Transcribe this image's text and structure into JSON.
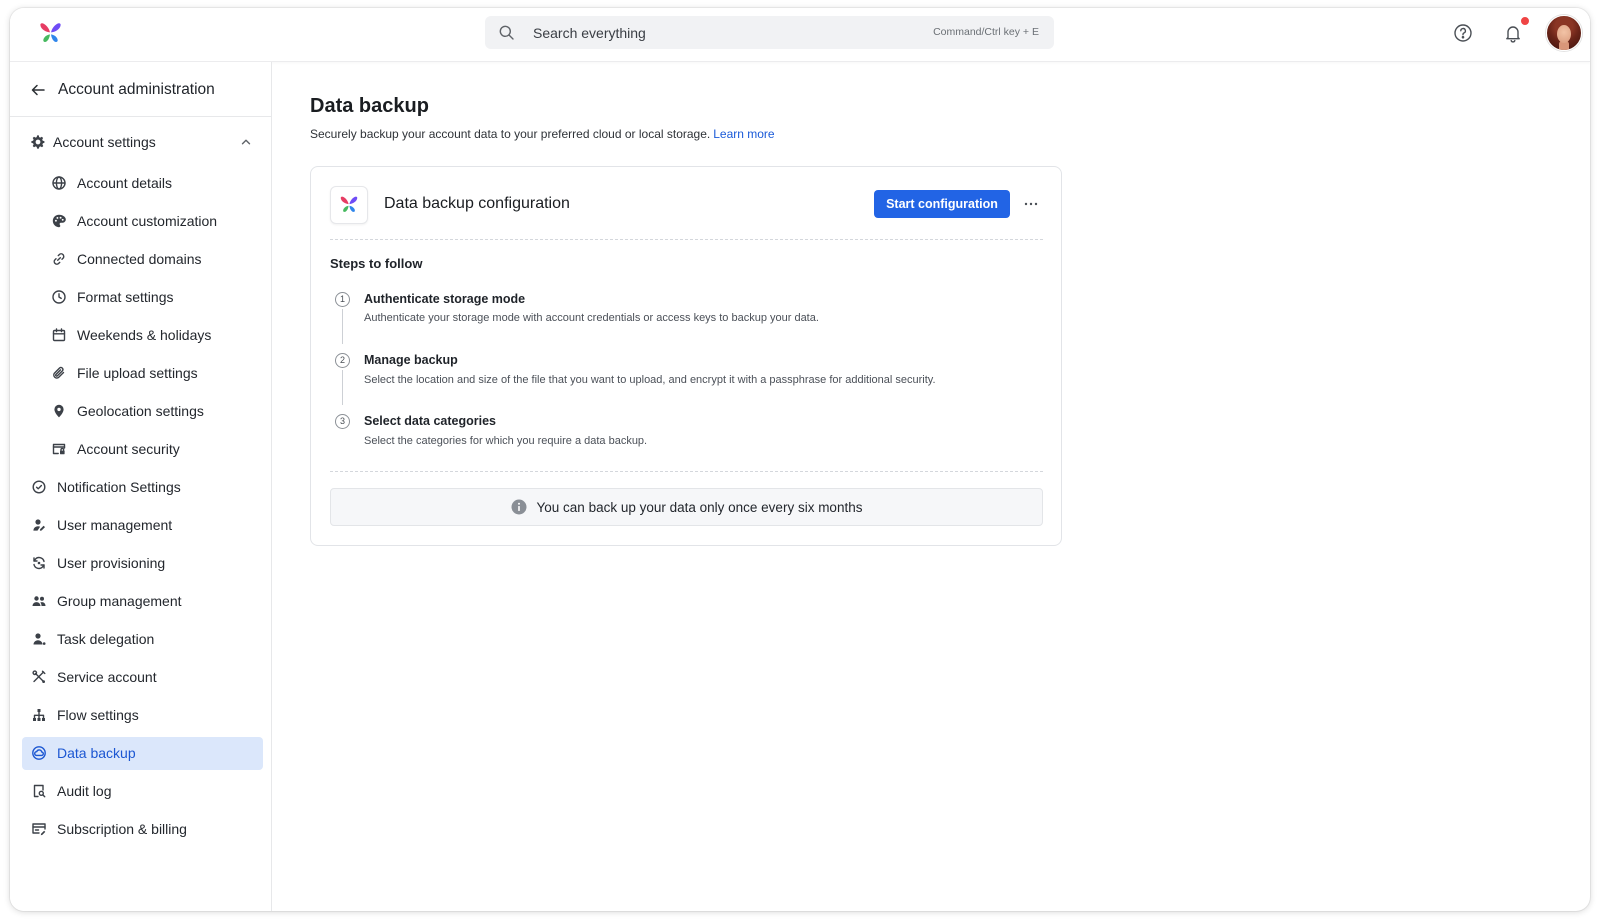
{
  "app": {
    "logo": "butterfly-logo"
  },
  "header": {
    "search": {
      "icon": "search-icon",
      "placeholder": "Search everything",
      "shortcut": "Command/Ctrl key + E"
    },
    "help_icon": "help-circle-icon",
    "notifications": {
      "icon": "bell-icon",
      "has_unread": true
    },
    "avatar": "user-avatar"
  },
  "sidebar": {
    "back_icon": "arrow-left-icon",
    "title": "Account administration",
    "account_settings": {
      "label": "Account settings",
      "icon": "gear-icon",
      "expanded": true,
      "items": [
        {
          "label": "Account details",
          "icon": "globe-icon"
        },
        {
          "label": "Account customization",
          "icon": "palette-icon"
        },
        {
          "label": "Connected domains",
          "icon": "link-icon"
        },
        {
          "label": "Format settings",
          "icon": "clock-icon"
        },
        {
          "label": "Weekends & holidays",
          "icon": "calendar-icon"
        },
        {
          "label": "File upload settings",
          "icon": "paperclip-icon"
        },
        {
          "label": "Geolocation settings",
          "icon": "map-pin-icon"
        },
        {
          "label": "Account security",
          "icon": "window-lock-icon"
        }
      ]
    },
    "items": [
      {
        "label": "Notification Settings",
        "icon": "notification-settings-icon"
      },
      {
        "label": "User management",
        "icon": "user-edit-icon"
      },
      {
        "label": "User provisioning",
        "icon": "sync-icon"
      },
      {
        "label": "Group management",
        "icon": "group-icon"
      },
      {
        "label": "Task delegation",
        "icon": "user-delegate-icon"
      },
      {
        "label": "Service account",
        "icon": "tools-icon"
      },
      {
        "label": "Flow settings",
        "icon": "hierarchy-icon"
      },
      {
        "label": "Data backup",
        "icon": "cloud-backup-icon",
        "active": true
      },
      {
        "label": "Audit log",
        "icon": "audit-log-icon"
      },
      {
        "label": "Subscription & billing",
        "icon": "billing-icon"
      }
    ]
  },
  "main": {
    "title": "Data backup",
    "subtitle": "Securely backup your account data to your preferred cloud or local storage.",
    "learn_more": "Learn more",
    "card": {
      "logo": "butterfly-logo",
      "title": "Data backup configuration",
      "primary_button": "Start configuration",
      "more_icon": "more-horizontal-icon",
      "steps_heading": "Steps to follow",
      "steps": [
        {
          "number": "1",
          "title": "Authenticate storage mode",
          "description": "Authenticate your storage mode with account credentials or access keys to backup your data."
        },
        {
          "number": "2",
          "title": "Manage backup",
          "description": "Select the location and size of the file that you want to upload, and encrypt it with a passphrase for additional security."
        },
        {
          "number": "3",
          "title": "Select data categories",
          "description": "Select the categories for which you require a data backup."
        }
      ],
      "notice": {
        "icon": "info-icon",
        "text": "You can back up your data only once every six months"
      }
    }
  },
  "colors": {
    "accent": "#2264e5",
    "accent_text": "#1c57d2",
    "link": "#1a5ad8",
    "active_bg": "#dbe7fb",
    "notification_dot": "#ef4444",
    "logo_pink": "#e63c63",
    "logo_violet": "#6f4cf6",
    "logo_green": "#46b95f",
    "logo_blue": "#2f86eb"
  }
}
